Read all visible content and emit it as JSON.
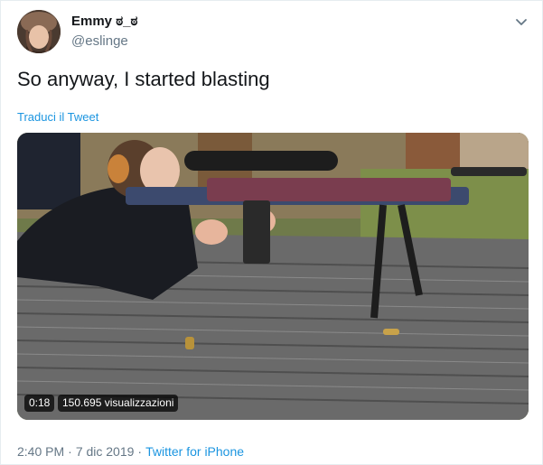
{
  "user": {
    "display_name": "Emmy ಠ_ಠ",
    "handle": "@eslinge",
    "avatar_icon": "profile-avatar"
  },
  "tweet": {
    "text": "So anyway, I started blasting",
    "translate_label": "Traduci il Tweet"
  },
  "video": {
    "duration": "0:18",
    "views": "150.695 visualizzazioni"
  },
  "footer": {
    "time": "2:40 PM",
    "separator": "·",
    "date": "7 dic 2019",
    "source": "Twitter for iPhone"
  },
  "menu": {
    "icon": "chevron-down-icon"
  },
  "colors": {
    "link": "#1b95e0",
    "muted": "#657786",
    "text": "#14171a"
  }
}
